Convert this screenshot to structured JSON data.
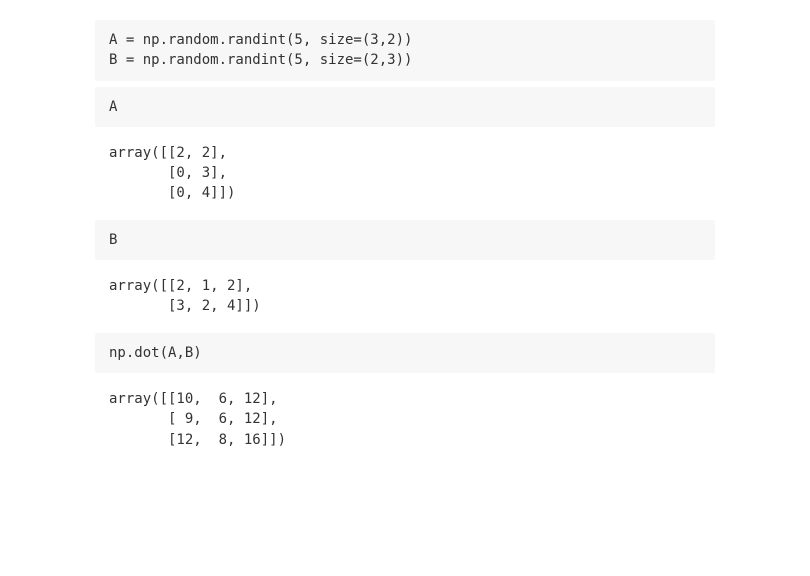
{
  "cells": [
    {
      "type": "input",
      "lines": [
        "A = np.random.randint(5, size=(3,2))",
        "B = np.random.randint(5, size=(2,3))"
      ]
    },
    {
      "type": "input",
      "lines": [
        "A"
      ]
    },
    {
      "type": "output",
      "lines": [
        "array([[2, 2],",
        "       [0, 3],",
        "       [0, 4]])"
      ]
    },
    {
      "type": "input",
      "lines": [
        "B"
      ]
    },
    {
      "type": "output",
      "lines": [
        "array([[2, 1, 2],",
        "       [3, 2, 4]])"
      ]
    },
    {
      "type": "input",
      "lines": [
        "np.dot(A,B)"
      ]
    },
    {
      "type": "output",
      "lines": [
        "array([[10,  6, 12],",
        "       [ 9,  6, 12],",
        "       [12,  8, 16]])"
      ]
    }
  ]
}
